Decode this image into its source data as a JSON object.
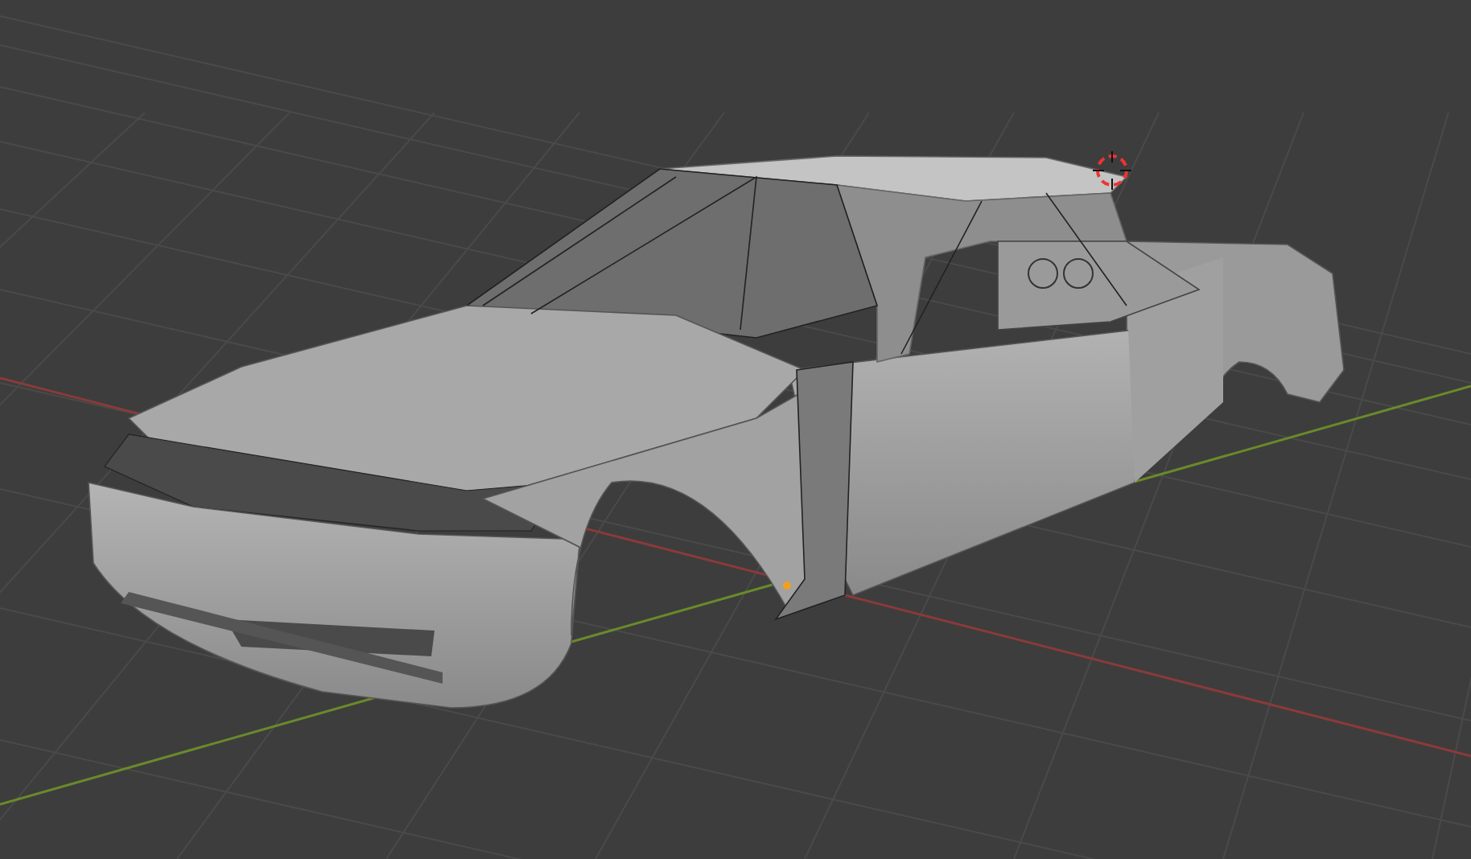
{
  "viewport": {
    "kind": "car-body",
    "cursor_visible": true,
    "origin_visible": true
  }
}
